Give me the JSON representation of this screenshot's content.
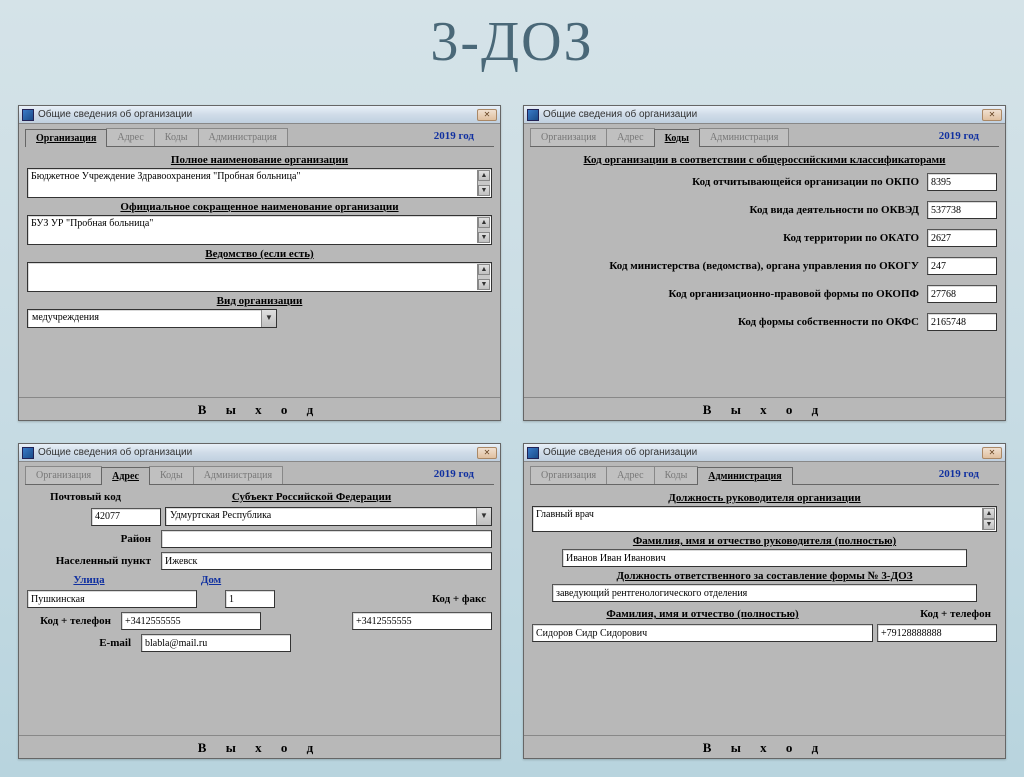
{
  "page_title": "3-ДОЗ",
  "window_title": "Общие сведения об организации",
  "tabs": [
    "Организация",
    "Адрес",
    "Коды",
    "Администрация"
  ],
  "year_label": "2019 год",
  "exit_label": "В ы х о д",
  "org": {
    "full_name_label": "Полное наименование организации",
    "full_name_value": "Бюджетное Учреждение Здравоохранения \"Пробная больница\"",
    "short_name_label": "Официальное сокращенное наименование организации",
    "short_name_value": "БУЗ УР \"Пробная больница\"",
    "agency_label": "Ведомство (если есть)",
    "agency_value": "",
    "kind_label": "Вид организации",
    "kind_value": "медучреждения"
  },
  "codes": {
    "header": "Код организации в соответствии с общероссийскими классификаторами",
    "rows": [
      {
        "label": "Код отчитывающейся организации по ОКПО",
        "value": "8395"
      },
      {
        "label": "Код вида деятельности по ОКВЭД",
        "value": "537738"
      },
      {
        "label": "Код территории по ОКАТО",
        "value": "2627"
      },
      {
        "label": "Код министерства (ведомства), органа управления по ОКОГУ",
        "value": "247"
      },
      {
        "label": "Код организационно-правовой формы по ОКОПФ",
        "value": "27768"
      },
      {
        "label": "Код формы собственности по ОКФС",
        "value": "2165748"
      }
    ]
  },
  "address": {
    "postcode_label": "Почтовый код",
    "postcode_value": "42077",
    "subject_label": "Субъект Российской Федерации",
    "subject_value": "Удмуртская Республика",
    "district_label": "Район",
    "district_value": "",
    "town_label": "Населенный пункт",
    "town_value": "Ижевск",
    "street_label": "Улица",
    "street_value": "Пушкинская",
    "house_label": "Дом",
    "house_value": "1",
    "phone_label": "Код + телефон",
    "phone_value": "+3412555555",
    "fax_label": "Код + факс",
    "fax_value": "+3412555555",
    "email_label": "E-mail",
    "email_value": "blabla@mail.ru"
  },
  "admin": {
    "chief_post_label": "Должность руководителя организации",
    "chief_post_value": "Главный врач",
    "chief_name_label": "Фамилия, имя и отчество руководителя (полностью)",
    "chief_name_value": "Иванов Иван Иванович",
    "resp_post_label": "Должность ответственного за составление формы № 3-ДОЗ",
    "resp_post_value": "заведующий рентгенологического отделения",
    "resp_name_label": "Фамилия, имя и отчество (полностью)",
    "resp_name_value": "Сидоров Сидр Сидорович",
    "resp_phone_label": "Код + телефон",
    "resp_phone_value": "+79128888888"
  }
}
